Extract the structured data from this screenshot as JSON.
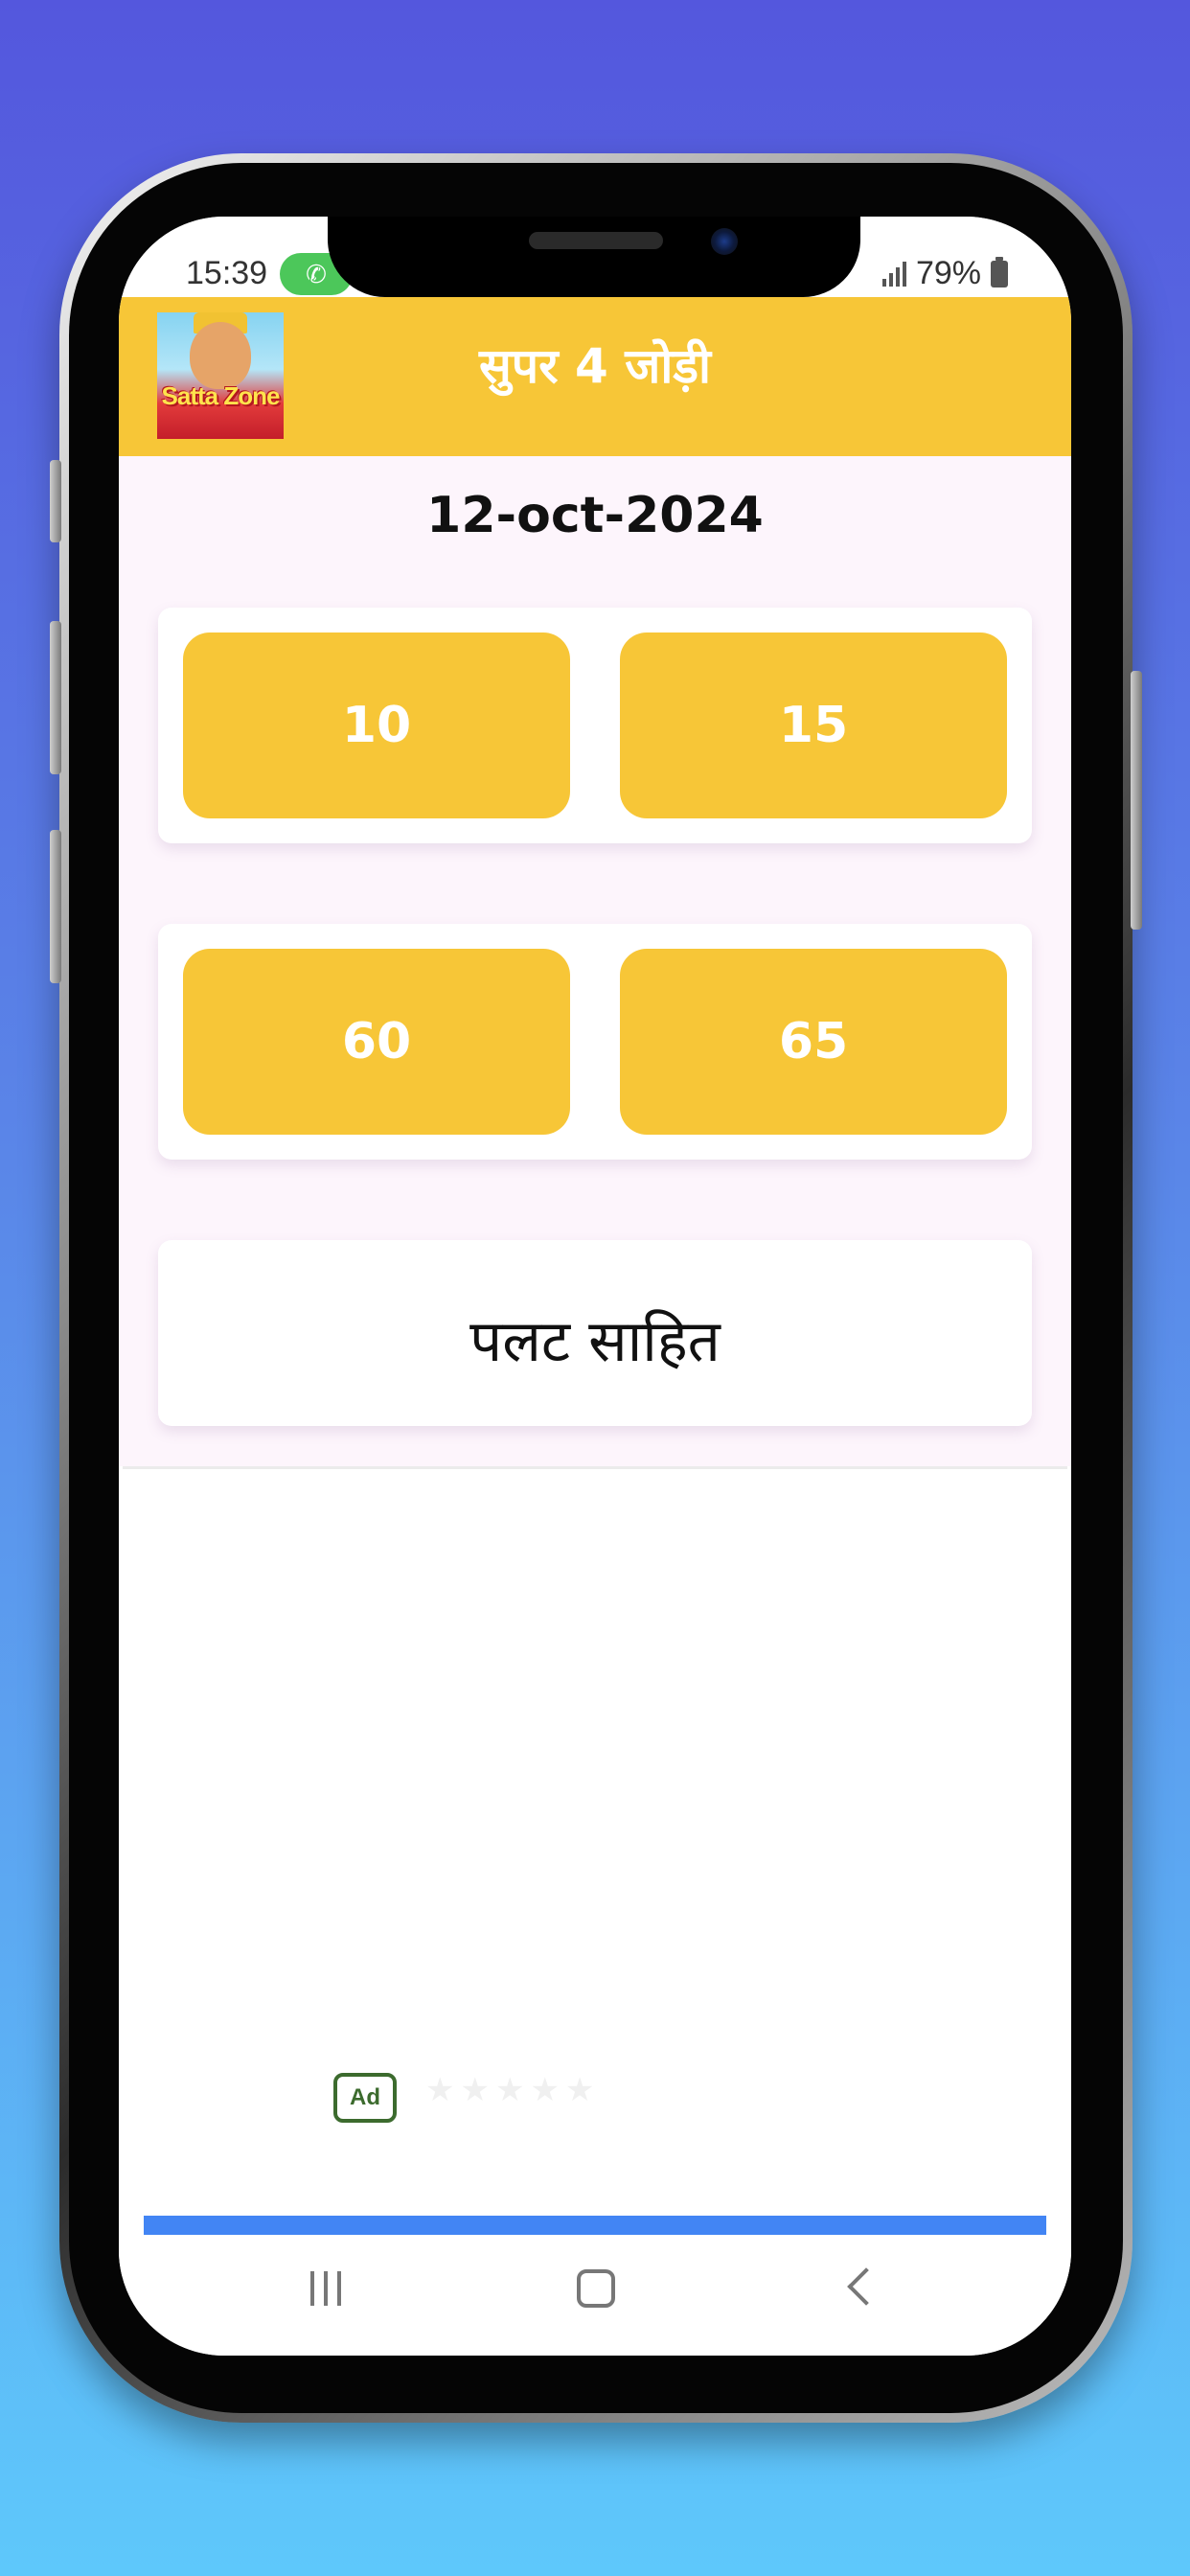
{
  "status_bar": {
    "time": "15:39",
    "battery": "79%"
  },
  "app_bar": {
    "title": "सुपर 4 जोड़ी",
    "logo_text": "Satta Zone"
  },
  "content": {
    "date": "12-oct-2024",
    "numbers": [
      "10",
      "15",
      "60",
      "65"
    ],
    "palat_label": "पलट साहित"
  },
  "ad": {
    "badge": "Ad"
  },
  "colors": {
    "accent": "#f7c637",
    "content_bg": "#fdf5fc",
    "ad_bar": "#4285f4"
  },
  "icons": {
    "call": "phone-icon",
    "signal": "signal-icon",
    "battery": "battery-icon",
    "recent_apps": "recent-apps-icon",
    "home": "home-icon",
    "back": "back-icon"
  }
}
